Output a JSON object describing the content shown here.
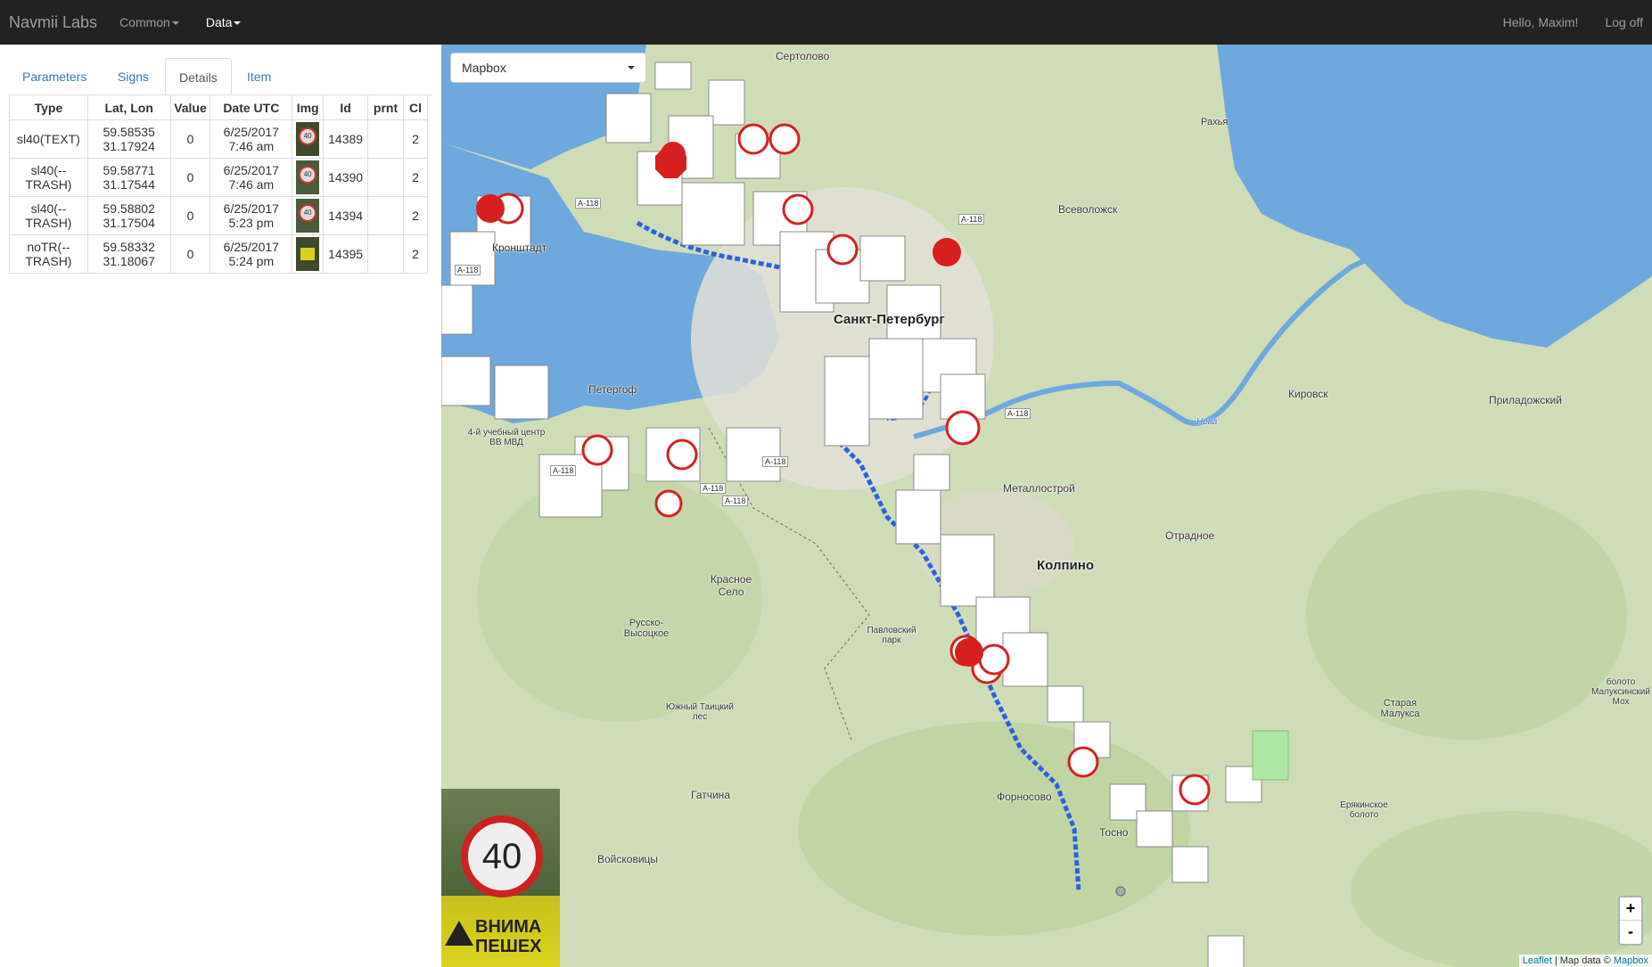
{
  "navbar": {
    "brand": "Navmii Labs",
    "menu": [
      {
        "label": "Common",
        "active": false
      },
      {
        "label": "Data",
        "active": true
      }
    ],
    "greeting": "Hello, Maxim!",
    "logoff": "Log off"
  },
  "tabs": [
    "Parameters",
    "Signs",
    "Details",
    "Item"
  ],
  "active_tab": "Details",
  "table": {
    "headers": [
      "Type",
      "Lat, Lon",
      "Value",
      "Date UTC",
      "Img",
      "Id",
      "prnt",
      "Cl"
    ],
    "rows": [
      {
        "type": "sl40(TEXT)",
        "lat": "59.58535",
        "lon": "31.17924",
        "value": "0",
        "date": "6/25/2017",
        "time": "7:46 am",
        "id": "14389",
        "prnt": "",
        "cl": "2"
      },
      {
        "type": "sl40(--TRASH)",
        "lat": "59.58771",
        "lon": "31.17544",
        "value": "0",
        "date": "6/25/2017",
        "time": "7:46 am",
        "id": "14390",
        "prnt": "",
        "cl": "2"
      },
      {
        "type": "sl40(--TRASH)",
        "lat": "59.58802",
        "lon": "31.17504",
        "value": "0",
        "date": "6/25/2017",
        "time": "5:23 pm",
        "id": "14394",
        "prnt": "",
        "cl": "2"
      },
      {
        "type": "noTR(--TRASH)",
        "lat": "59.58332",
        "lon": "31.18067",
        "value": "0",
        "date": "6/25/2017",
        "time": "5:24 pm",
        "id": "14395",
        "prnt": "",
        "cl": "2"
      }
    ],
    "thumb_sign_text": "40"
  },
  "map": {
    "layer_select": "Mapbox",
    "zoom_in": "+",
    "zoom_out": "-",
    "attribution_leaflet": "Leaflet",
    "attribution_sep": " | Map data © ",
    "attribution_mapbox": "Mapbox",
    "labels": {
      "sertolovo": "Сертолово",
      "vsevolozhsk": "Всеволожск",
      "kronshtadt": "Кронштадт",
      "peterhof": "Петергоф",
      "spb": "Санкт-Петербург",
      "kirovsk": "Кировск",
      "priladozhsky": "Приладожский",
      "metallostroy": "Металлострой",
      "otradnoe": "Отрадное",
      "kolpino": "Колпино",
      "krasnoe_selo": "Красное Село",
      "russko": "Русско-Высоцкое",
      "pavlovsky": "Павловский парк",
      "yuzhny": "Южный Таицкий лес",
      "gatchina": "Гатчина",
      "fornosovo": "Форносово",
      "tosno": "Тосно",
      "voyskovitsy": "Войсковицы",
      "rakhya": "Рахья",
      "neva": "Нева",
      "staraya_malukса": "Старая Малукса",
      "eryakinskoe": "Ерякинское болото",
      "school": "4-й учебный центр ВВ МВД",
      "bolota": "болото Малуксинский Мох"
    },
    "roads": [
      "A-118",
      "A-118",
      "A-118",
      "A-118",
      "A-118",
      "A-118",
      "A-118",
      "A-118"
    ],
    "photo_sign": "40",
    "photo_text": "ВНИМА ПЕШЕХ"
  }
}
